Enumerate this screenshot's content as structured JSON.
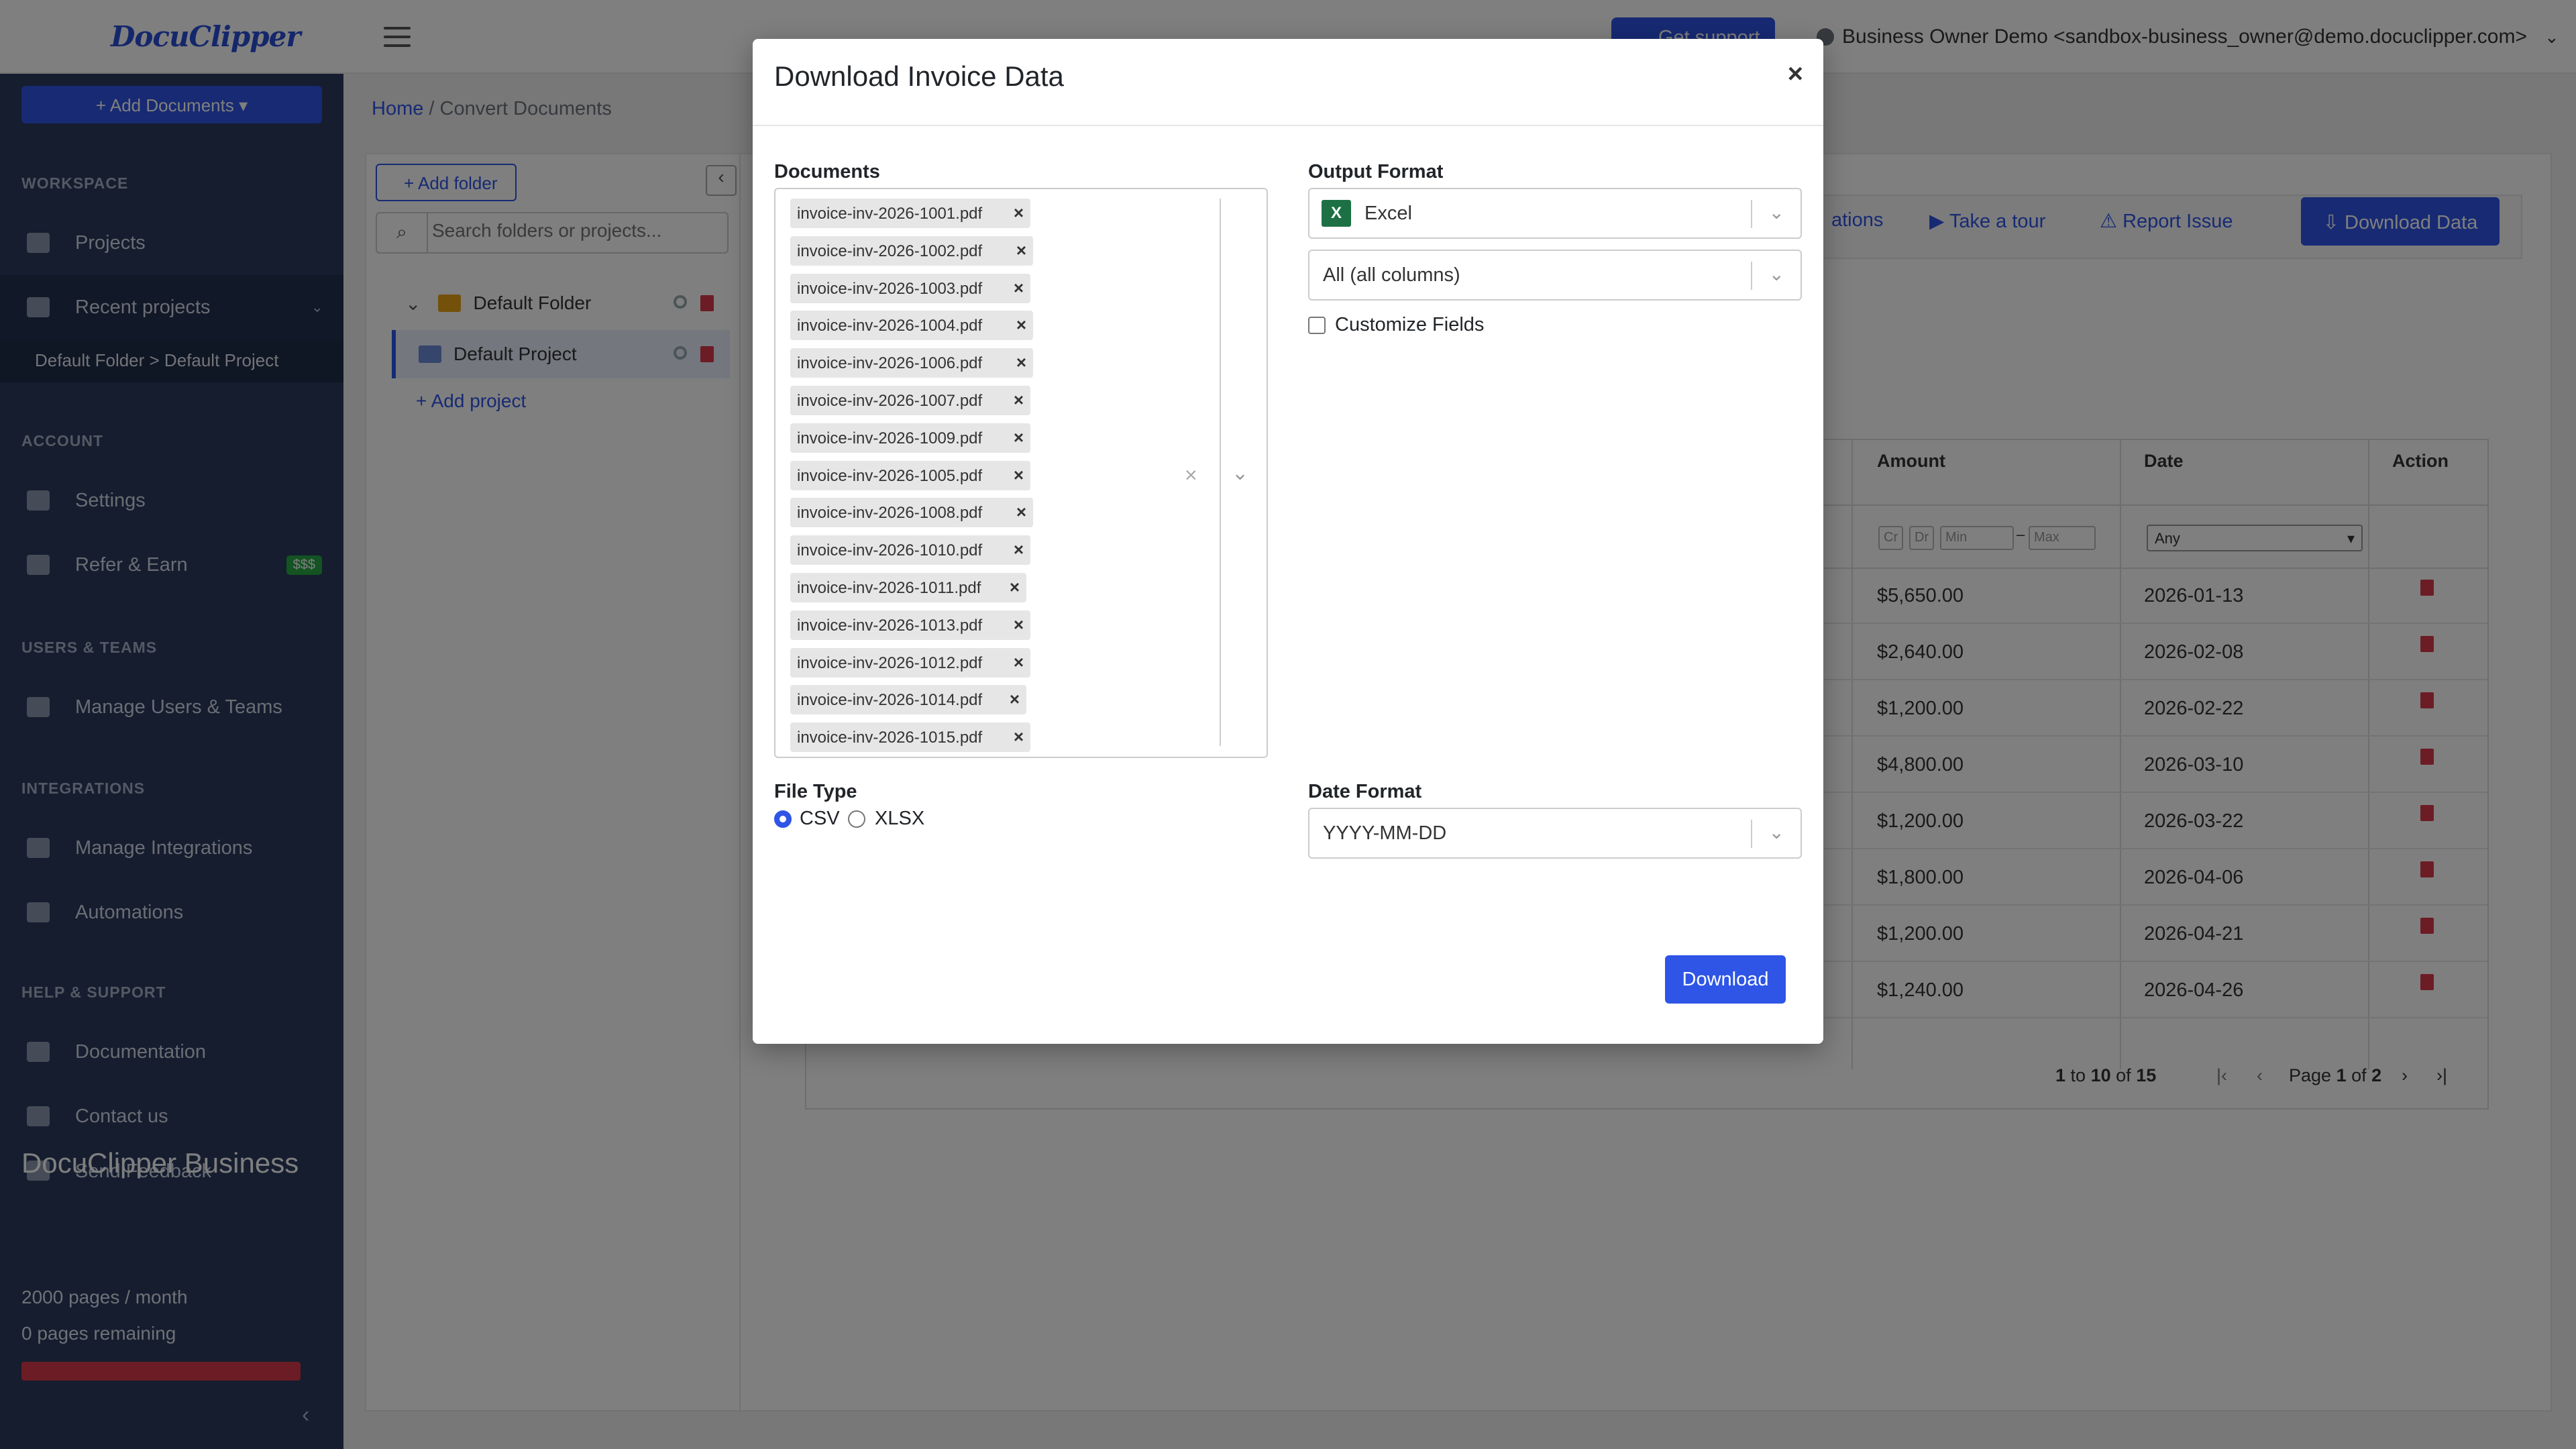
{
  "app": {
    "logo": "DocuClipper"
  },
  "header": {
    "support_label": "Get support",
    "user_label": "Business Owner Demo <sandbox-business_owner@demo.docuclipper.com>"
  },
  "sidebar": {
    "add_documents": "Add Documents",
    "sections": {
      "workspace": "WORKSPACE",
      "account": "ACCOUNT",
      "users": "USERS & TEAMS",
      "integrations": "INTEGRATIONS",
      "help": "HELP & SUPPORT"
    },
    "items": {
      "projects": "Projects",
      "recent": "Recent projects",
      "recent_sub": "Default Folder > Default Project",
      "settings": "Settings",
      "refer": "Refer & Earn",
      "refer_badge": "$$$",
      "users": "Manage Users & Teams",
      "integrations": "Manage Integrations",
      "automations": "Automations",
      "docs": "Documentation",
      "contact": "Contact us",
      "feedback": "Send Feedback"
    },
    "plan": {
      "name": "DocuClipper Business",
      "pages": "2000 pages / month",
      "remaining": "0 pages remaining"
    }
  },
  "breadcrumb": {
    "home": "Home",
    "sep": "/",
    "current": "Convert Documents"
  },
  "folders": {
    "add_folder": "Add folder",
    "search_placeholder": "Search folders or projects...",
    "folder": "Default Folder",
    "project": "Default Project",
    "add_project": "Add project"
  },
  "toolbar": {
    "integrations_partial": "ations",
    "tour": "Take a tour",
    "report": "Report Issue",
    "download_data": "Download Data"
  },
  "table": {
    "headers": {
      "amount": "Amount",
      "date": "Date",
      "action": "Action"
    },
    "filters": {
      "cr": "Cr",
      "dr": "Dr",
      "min": "Min",
      "dash": "–",
      "max": "Max",
      "date_any": "Any"
    },
    "rows": [
      {
        "amount": "$5,650.00",
        "date": "2026-01-13"
      },
      {
        "amount": "$2,640.00",
        "date": "2026-02-08"
      },
      {
        "amount": "$1,200.00",
        "date": "2026-02-22"
      },
      {
        "amount": "$4,800.00",
        "date": "2026-03-10"
      },
      {
        "amount": "$1,200.00",
        "date": "2026-03-22"
      },
      {
        "amount": "$1,800.00",
        "date": "2026-04-06"
      },
      {
        "amount": "$1,200.00",
        "date": "2026-04-21"
      },
      {
        "amount": "$1,240.00",
        "date": "2026-04-26"
      }
    ],
    "pager": {
      "from": "1",
      "to_word": "to",
      "to": "10",
      "of_word": "of",
      "total": "15",
      "page_word": "Page",
      "page": "1",
      "page_of": "of",
      "pages": "2"
    }
  },
  "modal": {
    "title": "Download Invoice Data",
    "close": "×",
    "documents_label": "Documents",
    "documents": [
      "invoice-inv-2026-1001.pdf",
      "invoice-inv-2026-1002.pdf",
      "invoice-inv-2026-1003.pdf",
      "invoice-inv-2026-1004.pdf",
      "invoice-inv-2026-1006.pdf",
      "invoice-inv-2026-1007.pdf",
      "invoice-inv-2026-1009.pdf",
      "invoice-inv-2026-1005.pdf",
      "invoice-inv-2026-1008.pdf",
      "invoice-inv-2026-1010.pdf",
      "invoice-inv-2026-1011.pdf",
      "invoice-inv-2026-1013.pdf",
      "invoice-inv-2026-1012.pdf",
      "invoice-inv-2026-1014.pdf",
      "invoice-inv-2026-1015.pdf"
    ],
    "tag_remove": "×",
    "output_format_label": "Output Format",
    "output_format": "Excel",
    "columns": "All (all columns)",
    "customize_fields": "Customize Fields",
    "file_type_label": "File Type",
    "file_type_options": [
      "CSV",
      "XLSX"
    ],
    "file_type_selected": "CSV",
    "date_format_label": "Date Format",
    "date_format": "YYYY-MM-DD",
    "download": "Download"
  },
  "colors": {
    "primary": "#2e55e6",
    "sidebar": "#2a3b5f",
    "danger": "#d9384a",
    "excel": "#1d7044"
  }
}
